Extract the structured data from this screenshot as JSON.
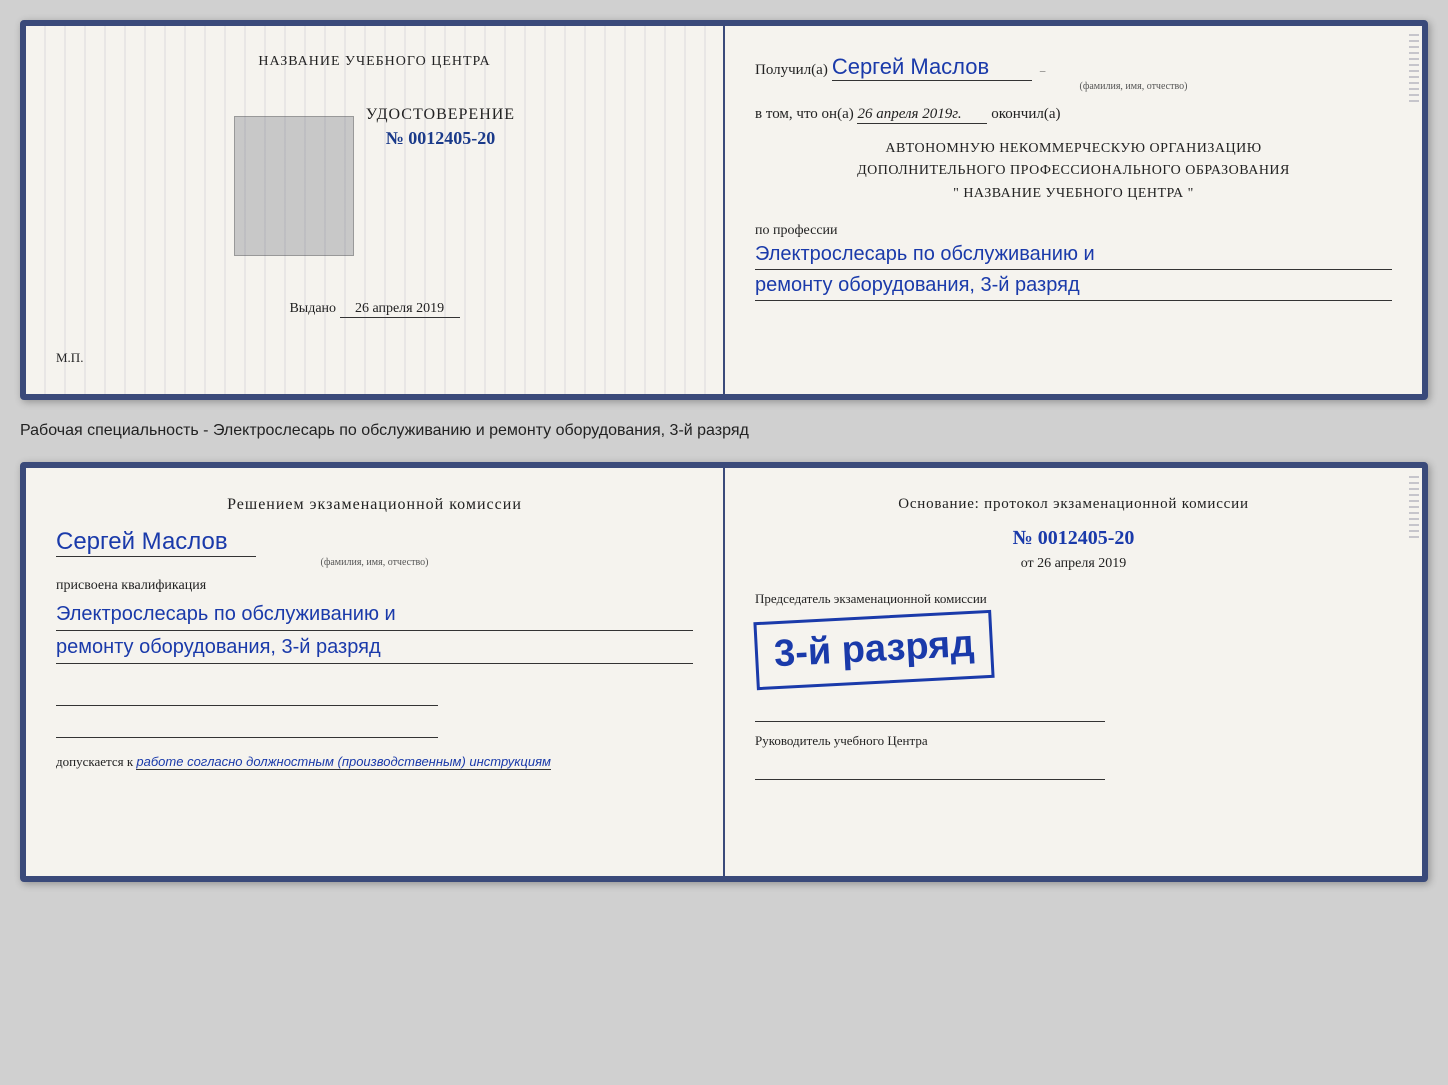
{
  "cert1": {
    "left": {
      "org_name": "НАЗВАНИЕ УЧЕБНОГО ЦЕНТРА",
      "cert_title": "УДОСТОВЕРЕНИЕ",
      "cert_number": "№ 0012405-20",
      "issued_label": "Выдано",
      "issued_date": "26 апреля 2019",
      "mp_label": "М.П."
    },
    "right": {
      "received_label": "Получил(а)",
      "received_name": "Сергей Маслов",
      "name_subtitle": "(фамилия, имя, отчество)",
      "date_prefix": "в том, что он(а)",
      "date_value": "26 апреля 2019г.",
      "date_suffix": "окончил(а)",
      "org_line1": "АВТОНОМНУЮ НЕКОММЕРЧЕСКУЮ ОРГАНИЗАЦИЮ",
      "org_line2": "ДОПОЛНИТЕЛЬНОГО ПРОФЕССИОНАЛЬНОГО ОБРАЗОВАНИЯ",
      "org_line3": "\"   НАЗВАНИЕ УЧЕБНОГО ЦЕНТРА   \"",
      "profession_label": "по профессии",
      "profession_line1": "Электрослесарь по обслуживанию и",
      "profession_line2": "ремонту оборудования, 3-й разряд"
    }
  },
  "description": "Рабочая специальность - Электрослесарь по обслуживанию и ремонту оборудования, 3-й разряд",
  "cert2": {
    "left": {
      "decision_title": "Решением экзаменационной комиссии",
      "person_name": "Сергей Маслов",
      "name_subtitle": "(фамилия, имя, отчество)",
      "qualification_label": "присвоена квалификация",
      "qualification_line1": "Электрослесарь по обслуживанию и",
      "qualification_line2": "ремонту оборудования, 3-й разряд",
      "admit_label": "допускается к",
      "admit_value": "работе согласно должностным (производственным) инструкциям"
    },
    "right": {
      "basis_title": "Основание: протокол экзаменационной комиссии",
      "protocol_number": "№  0012405-20",
      "protocol_date_prefix": "от",
      "protocol_date": "26 апреля 2019",
      "chairman_label": "Председатель экзаменационной комиссии",
      "stamp_main": "3-й разряд",
      "head_label": "Руководитель учебного Центра"
    }
  }
}
